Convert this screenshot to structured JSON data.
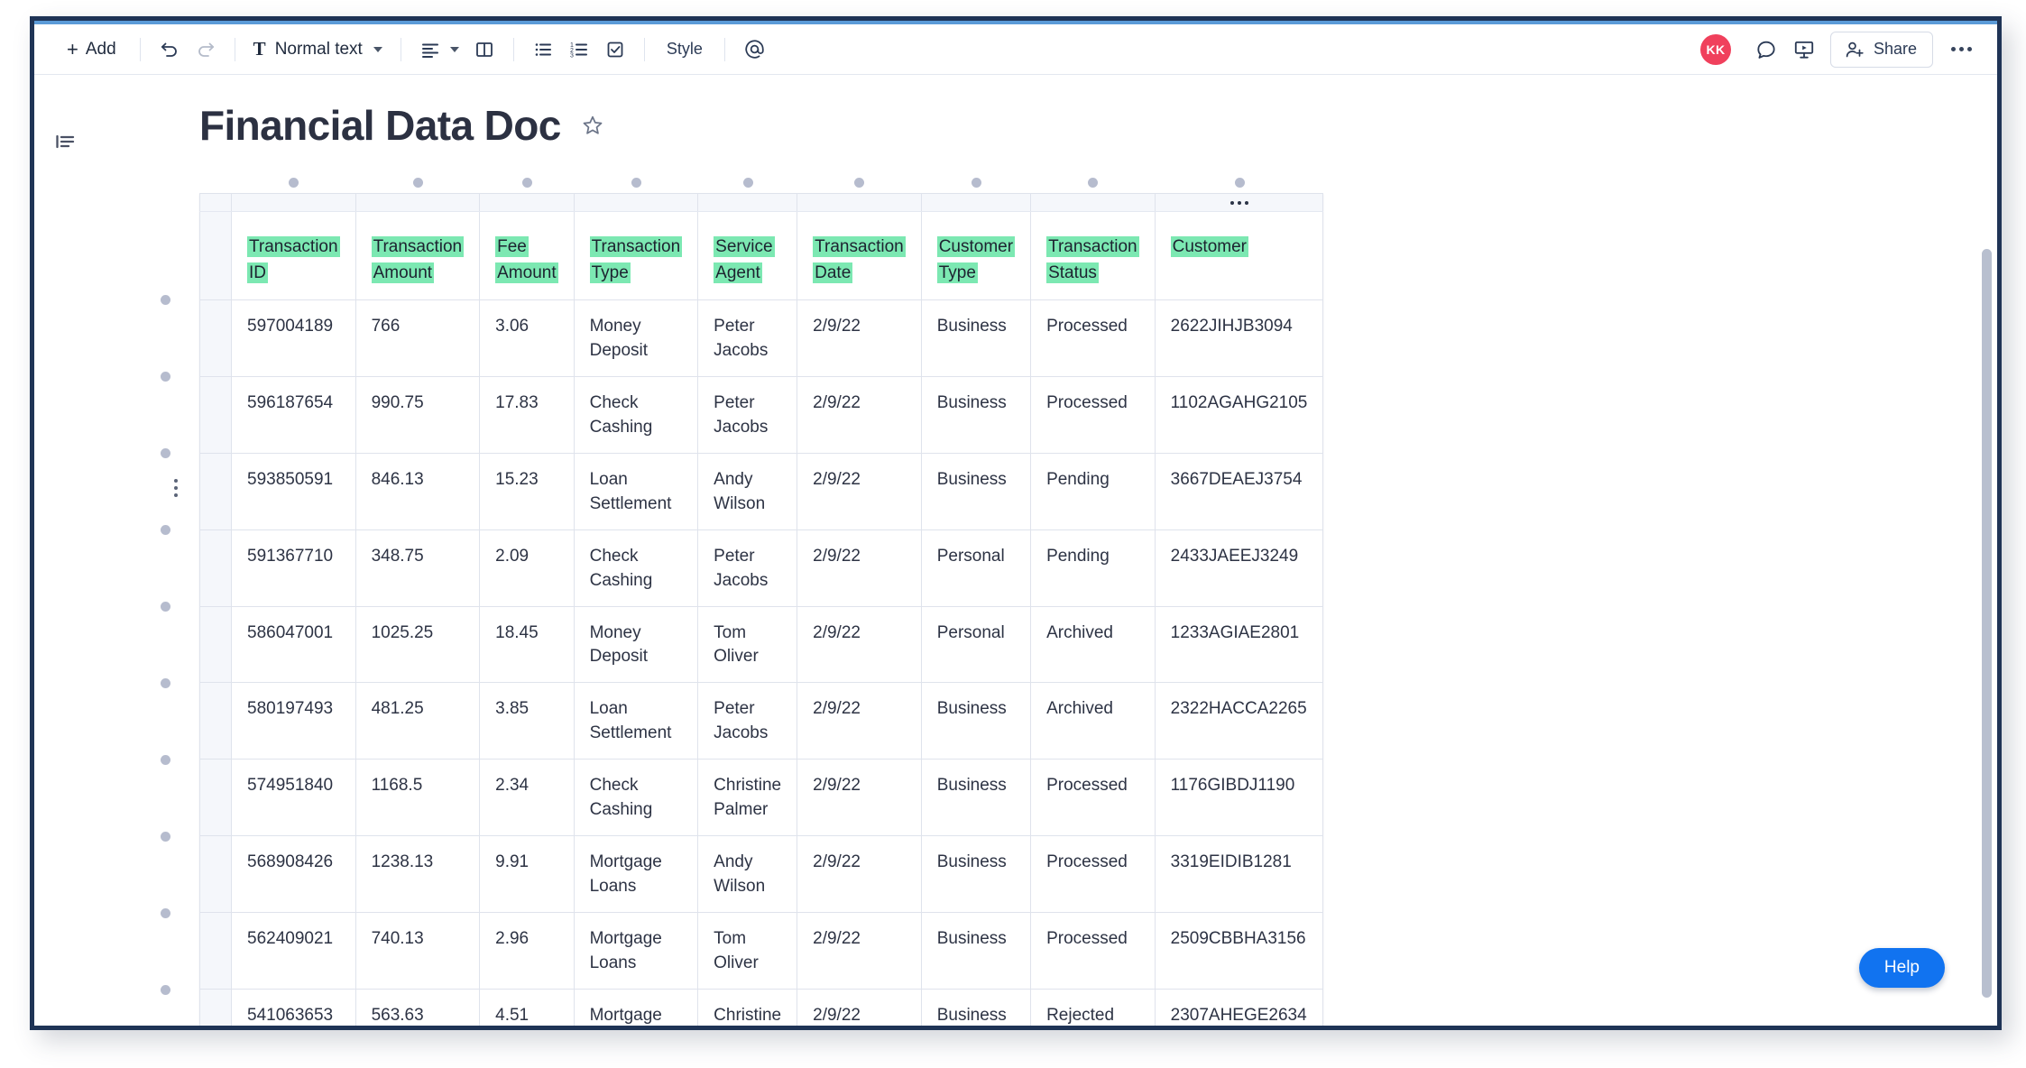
{
  "toolbar": {
    "add_label": "Add",
    "undo_icon": "undo-icon",
    "redo_icon": "redo-icon",
    "text_style_label": "Normal text",
    "align_icon": "align-left-icon",
    "columns_icon": "columns-icon",
    "bullet_list_icon": "bullet-list-icon",
    "numbered_list_icon": "numbered-list-icon",
    "checklist_icon": "checklist-icon",
    "style_label": "Style",
    "mention_icon": "at-mention-icon",
    "avatar_initials": "KK",
    "comment_icon": "comment-icon",
    "present_icon": "present-icon",
    "share_label": "Share",
    "more_icon": "more-horizontal-icon"
  },
  "document": {
    "outline_icon": "outline-icon",
    "title": "Financial Data Doc",
    "star_icon": "star-outline-icon",
    "table_menu_icon": "table-column-menu-icon"
  },
  "help": {
    "label": "Help"
  },
  "colors": {
    "highlight_green": "#7ce8b2",
    "accent_blue": "#1173f0",
    "avatar_red": "#f0405c",
    "window_border": "#1f3456"
  },
  "table": {
    "columns": [
      "Transaction ID",
      "Transaction Amount",
      "Fee Amount",
      "Transaction Type",
      "Service Agent",
      "Transaction Date",
      "Customer Type",
      "Transaction Status",
      "Customer"
    ],
    "rows": [
      {
        "transaction_id": "597004189",
        "transaction_amount": "766",
        "fee_amount": "3.06",
        "transaction_type": "Money Deposit",
        "service_agent": "Peter Jacobs",
        "transaction_date": "2/9/22",
        "customer_type": "Business",
        "transaction_status": "Processed",
        "customer": "2622JIHJB3094"
      },
      {
        "transaction_id": "596187654",
        "transaction_amount": "990.75",
        "fee_amount": "17.83",
        "transaction_type": "Check Cashing",
        "service_agent": "Peter Jacobs",
        "transaction_date": "2/9/22",
        "customer_type": "Business",
        "transaction_status": "Processed",
        "customer": "1102AGAHG2105"
      },
      {
        "transaction_id": "593850591",
        "transaction_amount": "846.13",
        "fee_amount": "15.23",
        "transaction_type": "Loan Settlement",
        "service_agent": "Andy Wilson",
        "transaction_date": "2/9/22",
        "customer_type": "Business",
        "transaction_status": "Pending",
        "customer": "3667DEAEJ3754"
      },
      {
        "transaction_id": "591367710",
        "transaction_amount": "348.75",
        "fee_amount": "2.09",
        "transaction_type": "Check Cashing",
        "service_agent": "Peter Jacobs",
        "transaction_date": "2/9/22",
        "customer_type": "Personal",
        "transaction_status": "Pending",
        "customer": "2433JAEEJ3249"
      },
      {
        "transaction_id": "586047001",
        "transaction_amount": "1025.25",
        "fee_amount": "18.45",
        "transaction_type": "Money Deposit",
        "service_agent": "Tom Oliver",
        "transaction_date": "2/9/22",
        "customer_type": "Personal",
        "transaction_status": "Archived",
        "customer": "1233AGIAE2801"
      },
      {
        "transaction_id": "580197493",
        "transaction_amount": "481.25",
        "fee_amount": "3.85",
        "transaction_type": "Loan Settlement",
        "service_agent": "Peter Jacobs",
        "transaction_date": "2/9/22",
        "customer_type": "Business",
        "transaction_status": "Archived",
        "customer": "2322HACCA2265"
      },
      {
        "transaction_id": "574951840",
        "transaction_amount": "1168.5",
        "fee_amount": "2.34",
        "transaction_type": "Check Cashing",
        "service_agent": "Christine Palmer",
        "transaction_date": "2/9/22",
        "customer_type": "Business",
        "transaction_status": "Processed",
        "customer": "1176GIBDJ1190"
      },
      {
        "transaction_id": "568908426",
        "transaction_amount": "1238.13",
        "fee_amount": "9.91",
        "transaction_type": "Mortgage Loans",
        "service_agent": "Andy Wilson",
        "transaction_date": "2/9/22",
        "customer_type": "Business",
        "transaction_status": "Processed",
        "customer": "3319EIDIB1281"
      },
      {
        "transaction_id": "562409021",
        "transaction_amount": "740.13",
        "fee_amount": "2.96",
        "transaction_type": "Mortgage Loans",
        "service_agent": "Tom Oliver",
        "transaction_date": "2/9/22",
        "customer_type": "Business",
        "transaction_status": "Processed",
        "customer": "2509CBBHA3156"
      },
      {
        "transaction_id": "541063653",
        "transaction_amount": "563.63",
        "fee_amount": "4.51",
        "transaction_type": "Mortgage Loans",
        "service_agent": "Christine Palmer",
        "transaction_date": "2/9/22",
        "customer_type": "Business",
        "transaction_status": "Rejected",
        "customer": "2307AHEGE2634"
      }
    ]
  }
}
